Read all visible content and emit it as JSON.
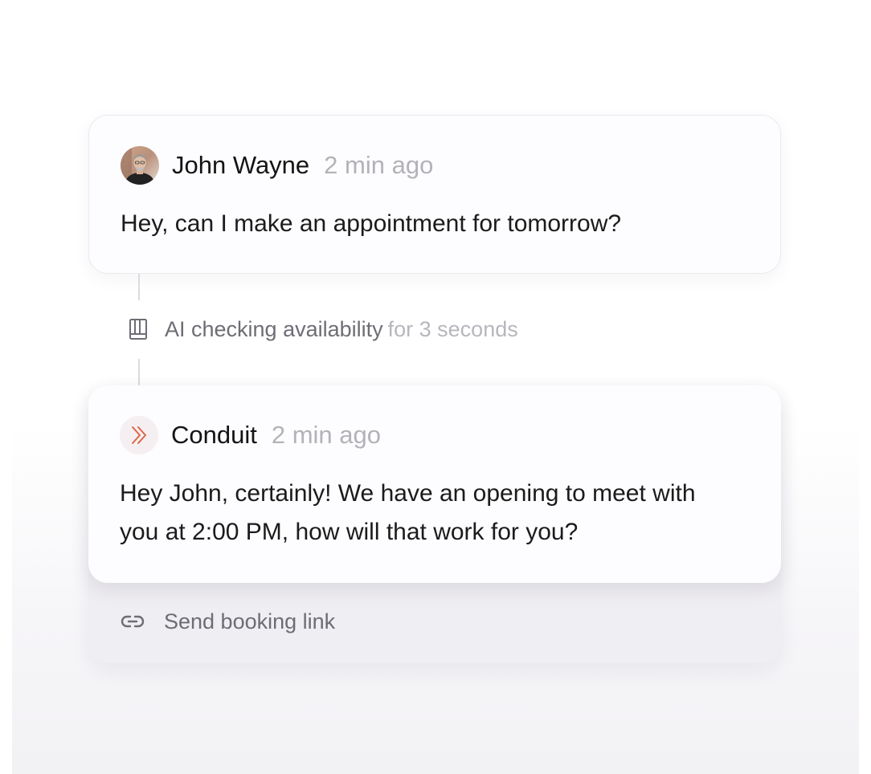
{
  "conversation": {
    "user_message": {
      "sender": "John Wayne",
      "time": "2 min ago",
      "text": "Hey, can I make an appointment for tomorrow?",
      "avatar_icon": "user-photo"
    },
    "activity": {
      "main": "AI checking availability",
      "sub": "for 3 seconds",
      "icon": "book-icon"
    },
    "bot_message": {
      "sender": "Conduit",
      "time": "2 min ago",
      "text": "Hey John, certainly! We have an opening to meet with you at 2:00 PM, how will that work for you?",
      "logo_icon": "double-chevron-right",
      "logo_color": "#d9684a"
    },
    "action": {
      "label": "Send booking link",
      "icon": "link-icon"
    }
  }
}
